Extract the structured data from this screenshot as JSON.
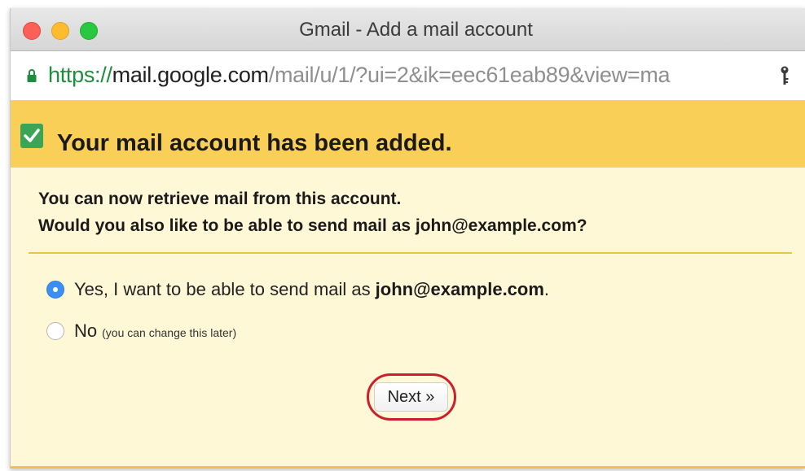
{
  "window": {
    "title": "Gmail - Add a mail account"
  },
  "address_bar": {
    "scheme": "https://",
    "host": "mail.google.com",
    "path": "/mail/u/1/?ui=2&ik=eec61eab89&view=ma",
    "lock_icon": "lock-icon",
    "key_icon": "key-icon"
  },
  "banner": {
    "check_icon": "checkmark-icon",
    "text": "Your mail account has been added."
  },
  "message": {
    "line1": "You can now retrieve mail from this account.",
    "line2": "Would you also like to be able to send mail as john@example.com?"
  },
  "options": {
    "yes": {
      "label": "Yes, I want to be able to send mail as",
      "email": "john@example.com",
      "period": ".",
      "selected": true
    },
    "no": {
      "label": "No",
      "note": "(you can change this later)",
      "selected": false
    }
  },
  "next_button": {
    "label": "Next »"
  },
  "colors": {
    "banner_bg": "#f9cf58",
    "content_bg": "#fff8d6",
    "highlight_ring": "#cc1f2d",
    "radio_selected": "#3b8ef2",
    "url_scheme": "#1e8e3e"
  }
}
